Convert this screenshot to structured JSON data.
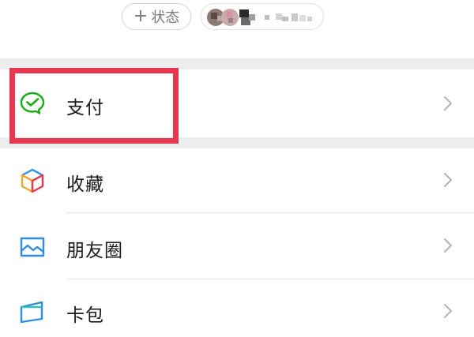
{
  "header": {
    "status_button": {
      "plus": "+",
      "label": "状态"
    }
  },
  "menu": {
    "items": [
      {
        "label": "支付",
        "icon": "wechat-pay-icon"
      },
      {
        "label": "收藏",
        "icon": "favorites-cube-icon"
      },
      {
        "label": "朋友圈",
        "icon": "moments-image-icon"
      },
      {
        "label": "卡包",
        "icon": "card-wallet-icon"
      }
    ]
  },
  "colors": {
    "highlight": "#e8384f",
    "pay_green": "#1aad19",
    "moments_blue": "#2e8ce6",
    "separator": "#ededed"
  }
}
